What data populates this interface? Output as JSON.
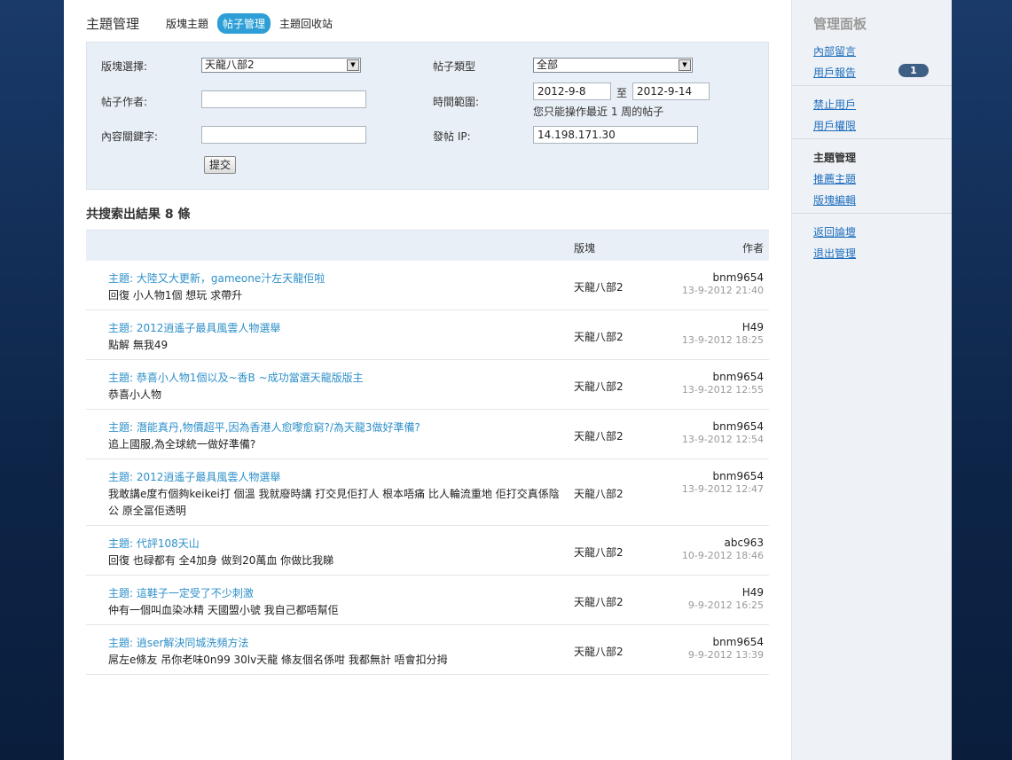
{
  "header": {
    "title": "主題管理",
    "tabs": [
      {
        "label": "版塊主題",
        "active": false
      },
      {
        "label": "帖子管理",
        "active": true
      },
      {
        "label": "主題回收站",
        "active": false
      }
    ]
  },
  "search": {
    "forum_label": "版塊選擇:",
    "forum_value": "天龍八部2",
    "type_label": "帖子類型",
    "type_value": "全部",
    "author_label": "帖子作者:",
    "author_value": "",
    "time_label": "時間範圍:",
    "date_from": "2012-9-8",
    "date_to_sep": "至",
    "date_to": "2012-9-14",
    "time_hint": "您只能操作最近 1 周的帖子",
    "keyword_label": "內容關鍵字:",
    "keyword_value": "",
    "ip_label": "發帖 IP:",
    "ip_value": "14.198.171.30",
    "submit_label": "提交"
  },
  "results": {
    "count_text": "共搜索出結果 8 條",
    "col_forum": "版塊",
    "col_author": "作者",
    "rows": [
      {
        "subject": "主題:  大陸又大更新，gameone汁左天龍佢啦",
        "body": "回復 小人物1個 想玩 求帶升",
        "forum": "天龍八部2",
        "author": "bnm9654",
        "time": "13-9-2012 21:40"
      },
      {
        "subject": "主題:  2012逍遙子最具風雲人物選舉",
        "body": "點解 無我49",
        "forum": "天龍八部2",
        "author": "H49",
        "time": "13-9-2012 18:25"
      },
      {
        "subject": "主題:  恭喜小人物1個以及~香Β ~成功當選天龍版版主",
        "body": "恭喜小人物",
        "forum": "天龍八部2",
        "author": "bnm9654",
        "time": "13-9-2012 12:55"
      },
      {
        "subject": "主題:  潛能真丹,物價超平,因為香港人愈嚟愈窮?/為天龍3做好準備?",
        "body": "追上國服,為全球統一做好準備?",
        "forum": "天龍八部2",
        "author": "bnm9654",
        "time": "13-9-2012 12:54"
      },
      {
        "subject": "主題:  2012逍遙子最具風雲人物選舉",
        "body": "我敢講e度冇個夠keikei打 個溫 我就廢時講 打交見佢打人 根本唔痛 比人輪流重地 佢打交真係陰公 原全冨佢透明",
        "forum": "天龍八部2",
        "author": "bnm9654",
        "time": "13-9-2012 12:47"
      },
      {
        "subject": "主題:  代評108天山",
        "body": "回復 也碌都有 全4加身 做到20萬血 你做比我睇",
        "forum": "天龍八部2",
        "author": "abc963",
        "time": "10-9-2012 18:46"
      },
      {
        "subject": "主題:  這鞋子一定受了不少刺激",
        "body": "仲有一個叫血染冰精 天國盟小號 我自己都唔幫佢",
        "forum": "天龍八部2",
        "author": "H49",
        "time": "9-9-2012 16:25"
      },
      {
        "subject": "主題:  逍ser解決同城洗頻方法",
        "body": "屌左e條友 吊你老味0n99 30lv天龍 條友個名係咁 我都無計 唔會扣分拇",
        "forum": "天龍八部2",
        "author": "bnm9654",
        "time": "9-9-2012 13:39"
      }
    ]
  },
  "sidebar": {
    "title": "管理面板",
    "links": {
      "internal_msg": "內部留言",
      "user_report": "用戶報告",
      "report_count": "1",
      "ban_user": "禁止用戶",
      "user_perm": "用戶權限",
      "topic_head": "主題管理",
      "recommend": "推薦主題",
      "forum_edit": "版塊編輯",
      "back_forum": "返回論壇",
      "logout": "退出管理"
    }
  },
  "colors": {
    "accent": "#2d9fd6",
    "link": "#1f6fbf",
    "subject": "#2d8fc9",
    "panel": "#e9eff6",
    "badge": "#3d5f84"
  }
}
